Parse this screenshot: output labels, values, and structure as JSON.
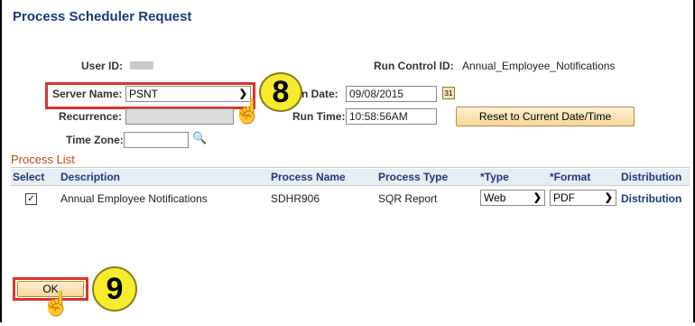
{
  "page": {
    "title": "Process Scheduler Request"
  },
  "user": {
    "label": "User ID:"
  },
  "run_control": {
    "label": "Run Control ID:",
    "value": "Annual_Employee_Notifications"
  },
  "server": {
    "label": "Server Name:",
    "value": "PSNT"
  },
  "run_date": {
    "label_visible": "n Date:",
    "value": "09/08/2015"
  },
  "recurrence": {
    "label": "Recurrence:",
    "value": ""
  },
  "run_time": {
    "label_visible": "Run Time:",
    "value": "10:58:56AM"
  },
  "reset_button": {
    "label": "Reset to Current Date/Time"
  },
  "time_zone": {
    "label": "Time Zone:",
    "value": ""
  },
  "process_list": {
    "heading": "Process List",
    "columns": [
      "Select",
      "Description",
      "Process Name",
      "Process Type",
      "*Type",
      "*Format",
      "Distribution"
    ],
    "rows": [
      {
        "selected": "✓",
        "description": "Annual Employee Notifications",
        "process_name": "SDHR906",
        "process_type": "SQR Report",
        "type": "Web",
        "format": "PDF",
        "distribution": "Distribution"
      }
    ]
  },
  "ok_button": {
    "label": "OK"
  },
  "callouts": {
    "step_server": "8",
    "step_ok": "9"
  },
  "colors": {
    "title": "#1d3a78",
    "highlight": "#d9342b",
    "callout": "#f6ec2d",
    "section": "#c0470f"
  }
}
